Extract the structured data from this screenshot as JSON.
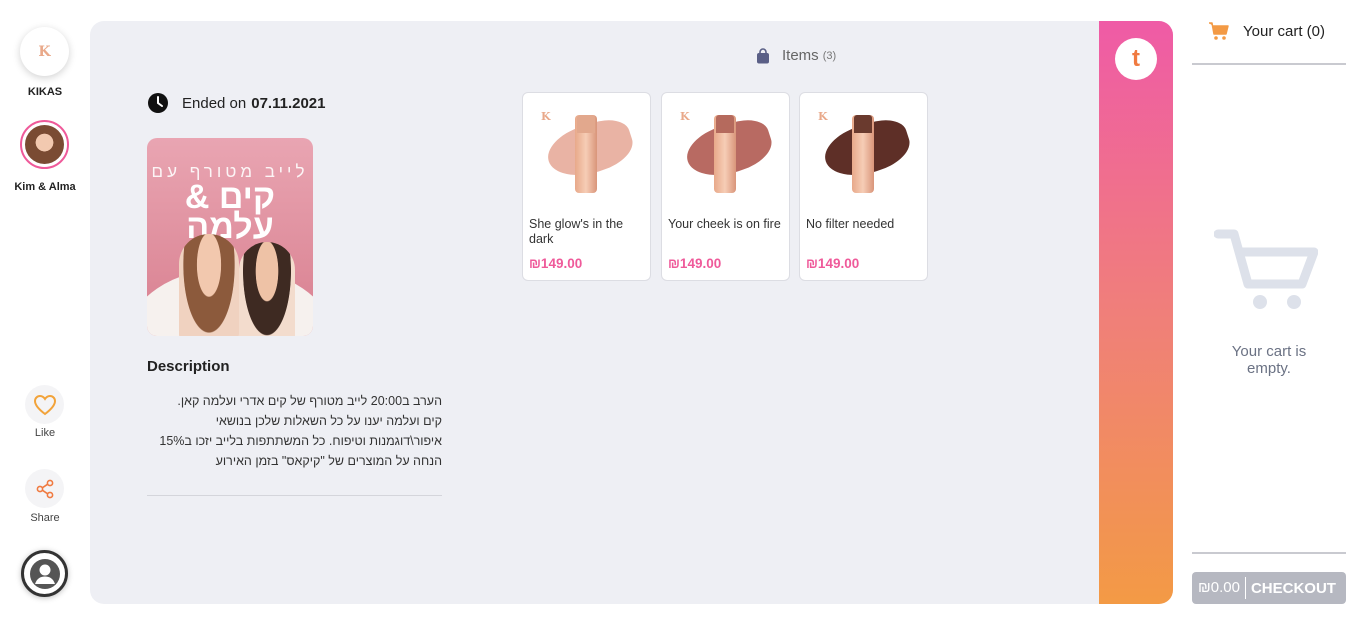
{
  "sidebar": {
    "brand_mark": "K",
    "brand_name": "KIKAS",
    "host_name": "Kim & Alma",
    "like_label": "Like",
    "share_label": "Share"
  },
  "event": {
    "ended_prefix": "Ended on",
    "ended_date": "07.11.2021",
    "image_line1": "לייב מטורף עם",
    "image_line2": "קים & עלמה",
    "description_title": "Description",
    "description_lines": [
      "הערב ב20:00 לייב מטורף של קים אדרי ועלמה קאן.",
      "קים ועלמה יענו על כל השאלות שלכן בנושאי",
      "איפור\\דוגמנות וטיפוח. כל המשתתפות בלייב יזכו ב15%",
      "הנחה על המוצרים של \"קיקאס\" בזמן האירוע"
    ]
  },
  "items": {
    "title": "Items",
    "count": "(3)",
    "products": [
      {
        "name": "She glow's in the dark",
        "price": "₪149.00",
        "swatch": "#e9b3a4",
        "cap": "#e2a88d"
      },
      {
        "name": "Your cheek is on fire",
        "price": "₪149.00",
        "swatch": "#b86a62",
        "cap": "#b56a5d"
      },
      {
        "name": "No filter needed",
        "price": "₪149.00",
        "swatch": "#5e2f27",
        "cap": "#6a3a2e"
      }
    ]
  },
  "strip": {
    "logo_letter": "t"
  },
  "cart": {
    "title": "Your cart (0)",
    "empty_line1": "Your cart is",
    "empty_line2": "empty.",
    "total": "₪0.00",
    "checkout_label": "CHECKOUT"
  },
  "colors": {
    "accent_pink": "#ef5a9a",
    "accent_orange": "#f39a45",
    "panel_bg": "#eeeff4"
  }
}
